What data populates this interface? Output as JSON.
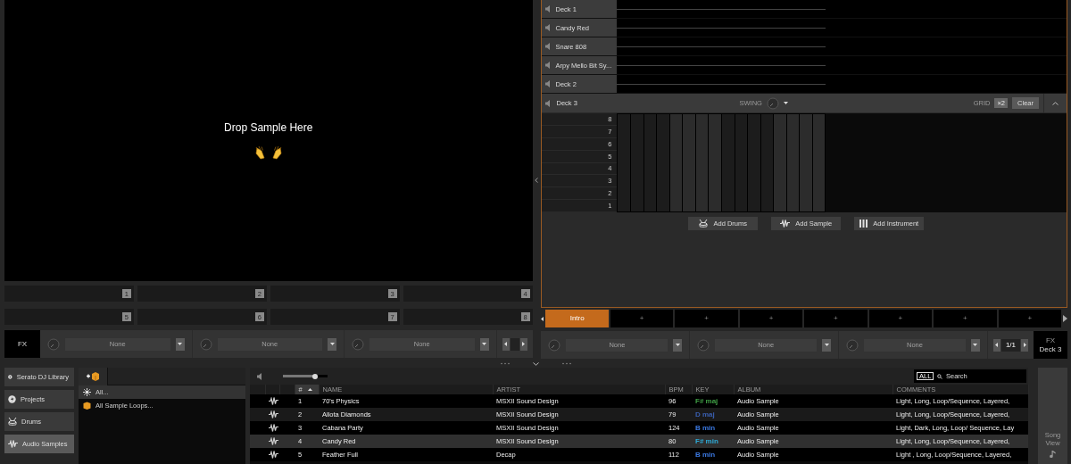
{
  "sample_area": {
    "title": "Drop Sample Here"
  },
  "pads": [
    {
      "number": "1"
    },
    {
      "number": "2"
    },
    {
      "number": "3"
    },
    {
      "number": "4"
    },
    {
      "number": "5"
    },
    {
      "number": "6"
    },
    {
      "number": "7"
    },
    {
      "number": "8"
    }
  ],
  "fx_left": {
    "label": "FX",
    "slots": [
      {
        "value": "None"
      },
      {
        "value": "None"
      },
      {
        "value": "None"
      }
    ]
  },
  "tracks": [
    {
      "name": "Deck 1"
    },
    {
      "name": "Candy Red"
    },
    {
      "name": "Snare 808"
    },
    {
      "name": "Arpy Mello Bit Sy..."
    },
    {
      "name": "Deck 2"
    }
  ],
  "active_track": {
    "name": "Deck 3",
    "swing_label": "SWING",
    "grid_label": "GRID",
    "grid_value": "×2",
    "clear": "Clear"
  },
  "note_rows": [
    "8",
    "7",
    "6",
    "5",
    "4",
    "3",
    "2",
    "1"
  ],
  "add_buttons": [
    {
      "kind": "drums",
      "label": "Add Drums"
    },
    {
      "kind": "sample",
      "label": "Add Sample"
    },
    {
      "kind": "instrument",
      "label": "Add Instrument"
    }
  ],
  "scenes": [
    {
      "label": "Intro",
      "selected": true
    },
    {
      "label": "+",
      "selected": false
    },
    {
      "label": "+",
      "selected": false
    },
    {
      "label": "+",
      "selected": false
    },
    {
      "label": "+",
      "selected": false
    },
    {
      "label": "+",
      "selected": false
    },
    {
      "label": "+",
      "selected": false
    },
    {
      "label": "+",
      "selected": false
    }
  ],
  "fx_right": {
    "slots": [
      {
        "value": "None"
      },
      {
        "value": "None"
      },
      {
        "value": "None"
      }
    ],
    "page": "1/1",
    "label": "FX",
    "deck": "Deck 3"
  },
  "sidebar": [
    {
      "kind": "library",
      "label": "Serato DJ Library",
      "selected": false
    },
    {
      "kind": "projects",
      "label": "Projects",
      "selected": false
    },
    {
      "kind": "drums",
      "label": "Drums",
      "selected": false
    },
    {
      "kind": "samples",
      "label": "Audio Samples",
      "selected": true
    }
  ],
  "crates": [
    {
      "kind": "all",
      "label": "All...",
      "selected": true
    },
    {
      "kind": "crate",
      "label": "All Sample Loops...",
      "selected": false
    }
  ],
  "library": {
    "volume": {
      "level": 0.72
    },
    "filter": "ALL",
    "search_placeholder": "Search",
    "columns": [
      {
        "label": "#",
        "sorted": true
      },
      {
        "label": "NAME",
        "sorted": false
      },
      {
        "label": "ARTIST",
        "sorted": false
      },
      {
        "label": "BPM",
        "sorted": false
      },
      {
        "label": "KEY",
        "sorted": false
      },
      {
        "label": "ALBUM",
        "sorted": false
      },
      {
        "label": "COMMENTS",
        "sorted": false
      }
    ],
    "rows": [
      {
        "num": "1",
        "name": "70's Physics",
        "artist": "MSXII Sound Design",
        "bpm": "96",
        "key": {
          "label": "F# maj",
          "color": "#3f9e45"
        },
        "album": "Audio Sample",
        "comments": "Light, Long, Loop/Sequence, Layered,",
        "selected": false
      },
      {
        "num": "2",
        "name": "Allota Diamonds",
        "artist": "MSXII Sound Design",
        "bpm": "79",
        "key": {
          "label": "D maj",
          "color": "#3a5fb0"
        },
        "album": "Audio Sample",
        "comments": "Light, Long, Loop/Sequence, Layered,",
        "selected": false
      },
      {
        "num": "3",
        "name": "Cabana Party",
        "artist": "MSXII Sound Design",
        "bpm": "124",
        "key": {
          "label": "B min",
          "color": "#3b78e0"
        },
        "album": "Audio Sample",
        "comments": "Light, Dark, Long, Loop/ Sequence, Lay",
        "selected": false
      },
      {
        "num": "4",
        "name": "Candy Red",
        "artist": "MSXII Sound Design",
        "bpm": "80",
        "key": {
          "label": "F# min",
          "color": "#2eaad6"
        },
        "album": "Audio Sample",
        "comments": "Light, Long, Loop/Sequence, Layered,",
        "selected": true
      },
      {
        "num": "5",
        "name": "Feather Full",
        "artist": "Decap",
        "bpm": "112",
        "key": {
          "label": "B min",
          "color": "#3b78e0"
        },
        "album": "Audio Sample",
        "comments": "Light , Long, Loop/Sequence, Layered,",
        "selected": false
      }
    ]
  },
  "song_view": {
    "label": "Song View"
  }
}
